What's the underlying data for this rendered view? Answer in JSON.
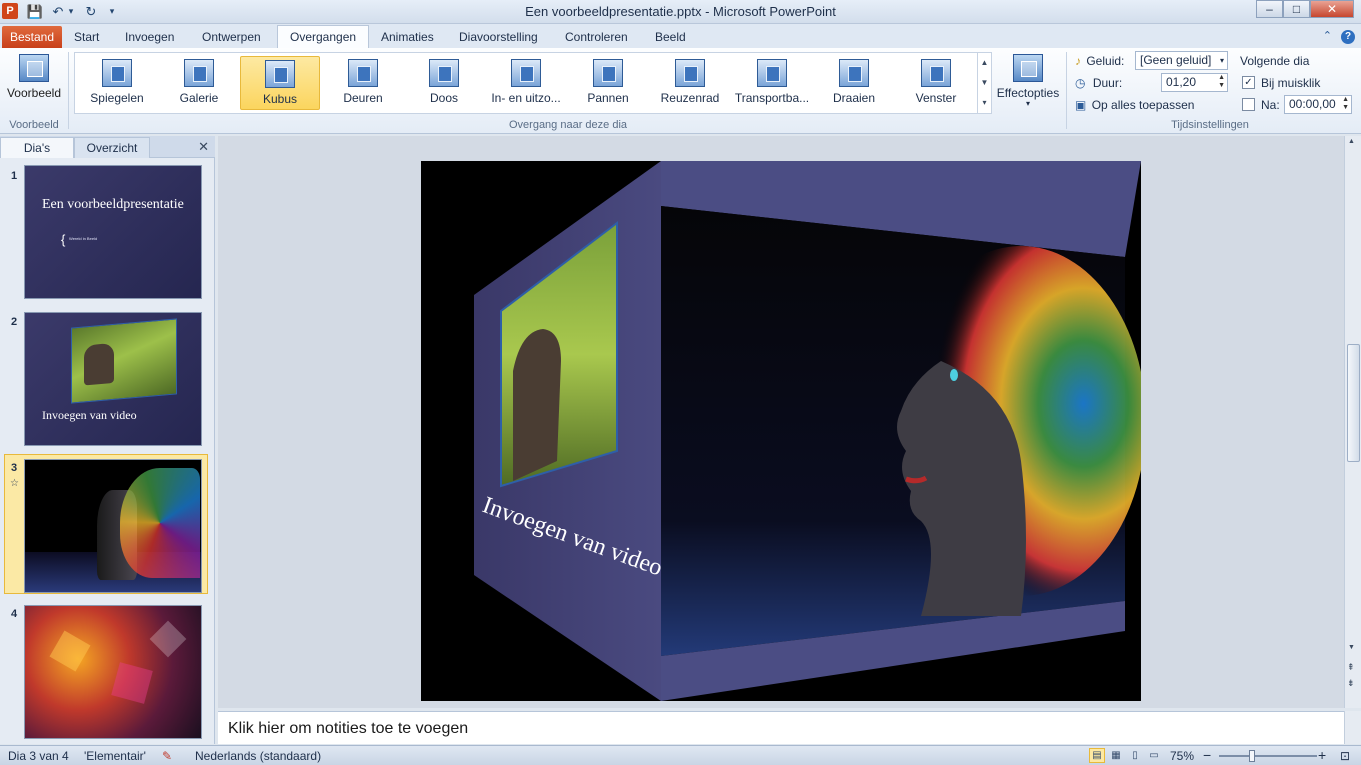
{
  "window": {
    "title": "Een voorbeeldpresentatie.pptx - Microsoft PowerPoint",
    "app_icon": "P"
  },
  "qat": {
    "save_icon": "💾",
    "undo_icon": "↶",
    "redo_icon": "↻",
    "customize_icon": "▾"
  },
  "window_controls": {
    "minimize": "–",
    "maximize": "□",
    "close": "✕"
  },
  "tabs": [
    {
      "label": "Bestand"
    },
    {
      "label": "Start"
    },
    {
      "label": "Invoegen"
    },
    {
      "label": "Ontwerpen"
    },
    {
      "label": "Overgangen"
    },
    {
      "label": "Animaties"
    },
    {
      "label": "Diavoorstelling"
    },
    {
      "label": "Controleren"
    },
    {
      "label": "Beeld"
    }
  ],
  "ribbon": {
    "preview": {
      "button_label": "Voorbeeld",
      "group_label": "Voorbeeld"
    },
    "transitions": {
      "group_label": "Overgang naar deze dia",
      "items": [
        {
          "label": "Spiegelen"
        },
        {
          "label": "Galerie"
        },
        {
          "label": "Kubus",
          "selected": true
        },
        {
          "label": "Deuren"
        },
        {
          "label": "Doos"
        },
        {
          "label": "In- en uitzo..."
        },
        {
          "label": "Pannen"
        },
        {
          "label": "Reuzenrad"
        },
        {
          "label": "Transportba..."
        },
        {
          "label": "Draaien"
        },
        {
          "label": "Venster"
        }
      ],
      "scroll_up": "▲",
      "scroll_down": "▼",
      "more": "▾"
    },
    "effect_options": {
      "label": "Effectopties",
      "arrow": "▾"
    },
    "timing": {
      "group_label": "Tijdsinstellingen",
      "sound_label": "Geluid:",
      "sound_value": "[Geen geluid]",
      "duration_label": "Duur:",
      "duration_value": "01,20",
      "apply_all_label": "Op alles toepassen",
      "next_slide_label": "Volgende dia",
      "on_click_label": "Bij muisklik",
      "on_click_checked": true,
      "after_label": "Na:",
      "after_checked": false,
      "after_value": "00:00,00"
    }
  },
  "slide_pane": {
    "tabs": [
      "Dia's",
      "Overzicht"
    ],
    "close_icon": "✕",
    "slides": [
      {
        "number": "1",
        "title": "Een voorbeeldpresentatie",
        "subtitle": "Wereld in Beeld"
      },
      {
        "number": "2",
        "title": "Invoegen van video"
      },
      {
        "number": "3",
        "selected": true
      },
      {
        "number": "4"
      }
    ],
    "transition_marker": "☆"
  },
  "slide": {
    "side_caption": "Invoegen van video"
  },
  "notes": {
    "placeholder": "Klik hier om notities toe te voegen"
  },
  "status": {
    "slide_info": "Dia 3 van 4",
    "theme": "'Elementair'",
    "language": "Nederlands (standaard)",
    "zoom": "75%",
    "zoom_out": "−",
    "zoom_in": "+"
  }
}
